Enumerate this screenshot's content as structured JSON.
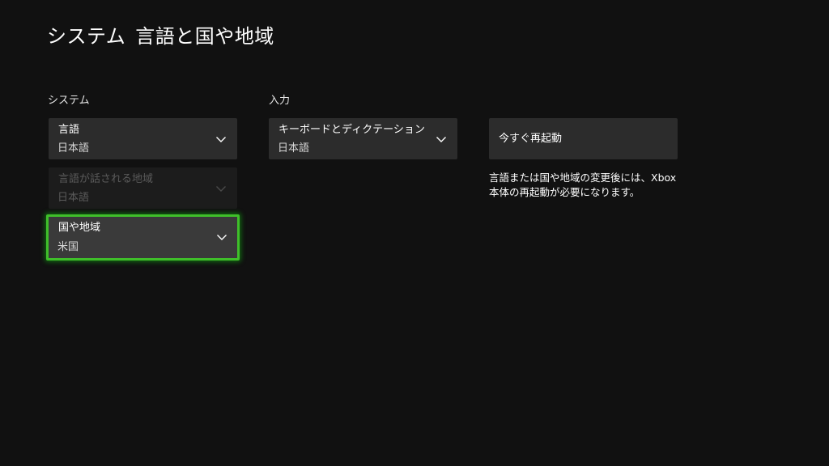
{
  "header": {
    "section": "システム",
    "title": "言語と国や地域"
  },
  "system_section": {
    "label": "システム",
    "language": {
      "label": "言語",
      "value": "日本語"
    },
    "spoken_region": {
      "label": "言語が話される地域",
      "value": "日本語"
    },
    "country_region": {
      "label": "国や地域",
      "value": "米国"
    }
  },
  "input_section": {
    "label": "入力",
    "keyboard": {
      "label": "キーボードとディクテーション",
      "value": "日本語"
    }
  },
  "restart": {
    "button_label": "今すぐ再起動",
    "note_line1": "言語または国や地域の変更後には、Xbox",
    "note_line2": "本体の再起動が必要になります。"
  },
  "colors": {
    "background": "#111111",
    "tile": "#2c2c2c",
    "focus_accent": "#3fbf2a"
  },
  "icons": {
    "dropdown": "chevron-down-icon"
  }
}
